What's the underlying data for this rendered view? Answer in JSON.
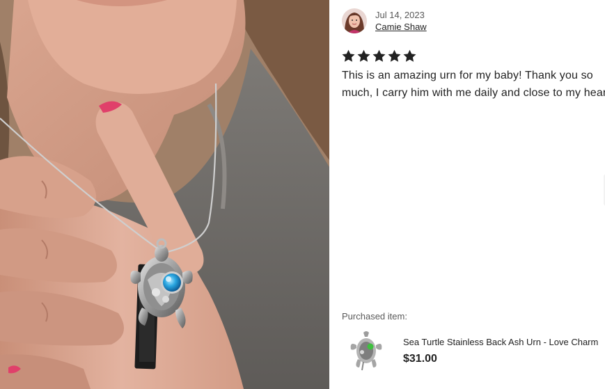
{
  "review": {
    "date": "Jul 14, 2023",
    "reviewer_name": "Camie Shaw",
    "rating": 5,
    "rating_max": 5,
    "text": "This is an amazing urn for my baby! Thank you so much, I carry him with me daily and close to my heart"
  },
  "purchase": {
    "label": "Purchased item:",
    "title": "Sea Turtle Stainless Back Ash Urn - Love Charm",
    "price": "$31.00"
  },
  "colors": {
    "star": "#222222",
    "gem": "#2aa6e0",
    "product_gem": "#3fbf3f"
  },
  "icons": {
    "star": "star-icon",
    "avatar": "avatar",
    "photo": "review-photo",
    "product": "product-thumbnail"
  }
}
